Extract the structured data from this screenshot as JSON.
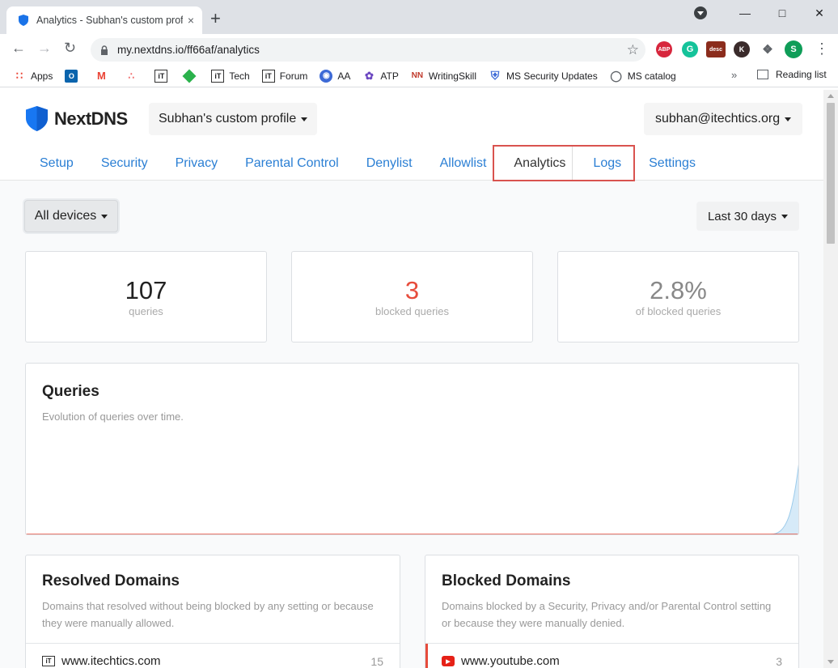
{
  "browser": {
    "tab_title": "Analytics - Subhan's custom profi",
    "tab_close": "×",
    "new_tab": "+",
    "url": "my.nextdns.io/ff66af/analytics",
    "ext_labels": {
      "abp": "ABP",
      "grammarly": "G",
      "desc": "desc",
      "k": "K",
      "profile": "S"
    },
    "bookmarks": [
      {
        "label": "Apps",
        "icon": "apps-grid-icon"
      },
      {
        "label": "",
        "icon": "outlook-icon"
      },
      {
        "label": "",
        "icon": "gmail-icon"
      },
      {
        "label": "",
        "icon": "asana-icon"
      },
      {
        "label": "",
        "icon": "itechtics-icon"
      },
      {
        "label": "",
        "icon": "feedly-icon"
      },
      {
        "label": "Tech",
        "icon": "itechtics-icon"
      },
      {
        "label": "Forum",
        "icon": "itechtics-icon"
      },
      {
        "label": "AA",
        "icon": "eye-icon"
      },
      {
        "label": "ATP",
        "icon": "feather-icon"
      },
      {
        "label": "WritingSkill",
        "icon": "nn-icon"
      },
      {
        "label": "MS Security Updates",
        "icon": "shield-icon"
      },
      {
        "label": "MS catalog",
        "icon": "globe-icon"
      }
    ],
    "bookmarks_more": "»",
    "reading_list": "Reading list"
  },
  "header": {
    "brand": "NextDNS",
    "profile": "Subhan's custom profile",
    "account": "subhan@itechtics.org",
    "tabs": [
      {
        "label": "Setup",
        "active": false
      },
      {
        "label": "Security",
        "active": false
      },
      {
        "label": "Privacy",
        "active": false
      },
      {
        "label": "Parental Control",
        "active": false
      },
      {
        "label": "Denylist",
        "active": false
      },
      {
        "label": "Allowlist",
        "active": false
      },
      {
        "label": "Analytics",
        "active": true
      },
      {
        "label": "Logs",
        "active": false
      },
      {
        "label": "Settings",
        "active": false
      }
    ]
  },
  "filters": {
    "devices": "All devices",
    "range": "Last 30 days"
  },
  "stats": [
    {
      "value": "107",
      "label": "queries",
      "color": "#222222"
    },
    {
      "value": "3",
      "label": "blocked queries",
      "color": "#e74c3c"
    },
    {
      "value": "2.8%",
      "label": "of blocked queries",
      "color": "#888888"
    }
  ],
  "queries": {
    "title": "Queries",
    "subtitle": "Evolution of queries over time."
  },
  "resolved": {
    "title": "Resolved Domains",
    "subtitle": "Domains that resolved without being blocked by any setting or because they were manually allowed.",
    "rows": [
      {
        "domain": "www.itechtics.com",
        "count": "15"
      }
    ]
  },
  "blocked": {
    "title": "Blocked Domains",
    "subtitle": "Domains blocked by a Security, Privacy and/or Parental Control setting or because they were manually denied.",
    "rows": [
      {
        "domain": "www.youtube.com",
        "count": "3"
      }
    ]
  },
  "colors": {
    "link": "#2b7fd4",
    "blocked": "#e74c3c",
    "highlight": "#d9534f",
    "chart_fill": "#cfe6f7"
  }
}
